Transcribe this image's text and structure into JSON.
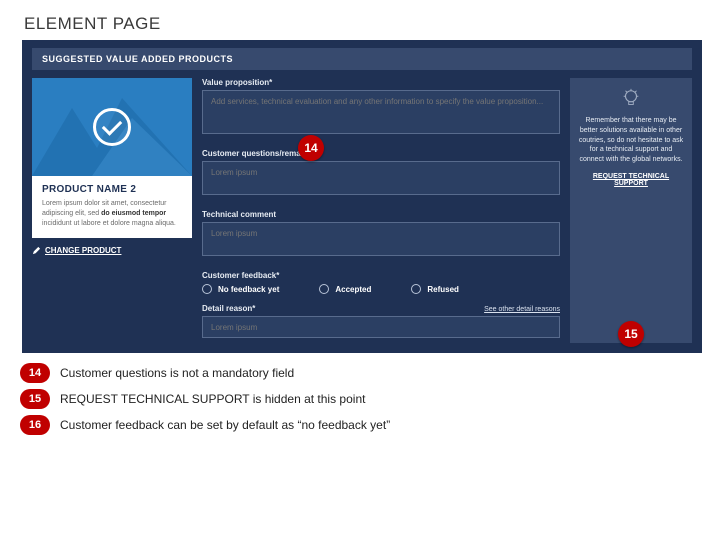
{
  "page_title": "ELEMENT PAGE",
  "section_header": "SUGGESTED VALUE ADDED PRODUCTS",
  "product": {
    "name": "PRODUCT NAME 2",
    "desc_pre": "Lorem ipsum dolor sit amet, consectetur adipiscing elit, sed ",
    "desc_bold": "do eiusmod tempor",
    "desc_post": " incididunt ut labore et dolore magna aliqua.",
    "change_label": "CHANGE PRODUCT"
  },
  "form": {
    "value_prop_label": "Value proposition*",
    "value_prop_placeholder": "Add services, technical evaluation and any other information to specify the value proposition...",
    "questions_label": "Customer questions/remarks*",
    "questions_placeholder": "Lorem ipsum",
    "tech_label": "Technical comment",
    "tech_placeholder": "Lorem ipsum",
    "feedback_label": "Customer feedback*",
    "feedback_options": {
      "none": "No feedback yet",
      "accepted": "Accepted",
      "refused": "Refused"
    },
    "detail_label": "Detail reason*",
    "detail_placeholder": "Lorem ipsum",
    "see_other": "See other detail reasons"
  },
  "sidebar": {
    "text": "Remember that there may be better solutions available in other coutries, so do not hesitate to ask for a technical support and connect with the global networks.",
    "link": "REQUEST TECHNICAL SUPPORT"
  },
  "callouts": {
    "a": "14",
    "b": "15"
  },
  "notes": [
    {
      "n": "14",
      "t": "Customer questions is not a mandatory field"
    },
    {
      "n": "15",
      "t": "REQUEST TECHNICAL SUPPORT is hidden at this point"
    },
    {
      "n": "16",
      "t": "Customer feedback can be set by default as “no feedback yet”"
    }
  ]
}
